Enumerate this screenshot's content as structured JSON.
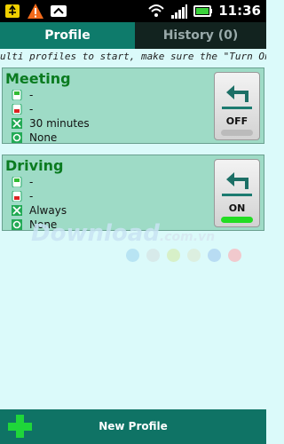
{
  "status_bar": {
    "time": "11:36",
    "icons": [
      "usb-icon",
      "warning-icon",
      "download-icon",
      "wifi-icon",
      "signal-icon",
      "battery-icon"
    ]
  },
  "tabs": [
    {
      "label": "Profile",
      "selected": true
    },
    {
      "label": "History (0)",
      "selected": false
    }
  ],
  "marquee": "ulti profiles to start, make sure the \"Turn On\" time",
  "profiles": [
    {
      "name": "Meeting",
      "rows": [
        "-",
        "-",
        "30 minutes",
        "None"
      ],
      "toggle": "OFF"
    },
    {
      "name": "Driving",
      "rows": [
        "-",
        "-",
        "Always",
        "None"
      ],
      "toggle": "ON"
    }
  ],
  "watermark": {
    "main": "Download",
    "suffix": ".com.vn"
  },
  "bottom": {
    "button_label": "New Profile"
  },
  "colors": {
    "accent": "#0e7b6b",
    "title_green": "#0a7b20",
    "on_green": "#22dd22",
    "off_gray": "#bbbbbb"
  },
  "dots": [
    "#b8e4f3",
    "#d7eaea",
    "#d7f0c8",
    "#dcefe0",
    "#b8dcf3",
    "#f1c9cd"
  ]
}
